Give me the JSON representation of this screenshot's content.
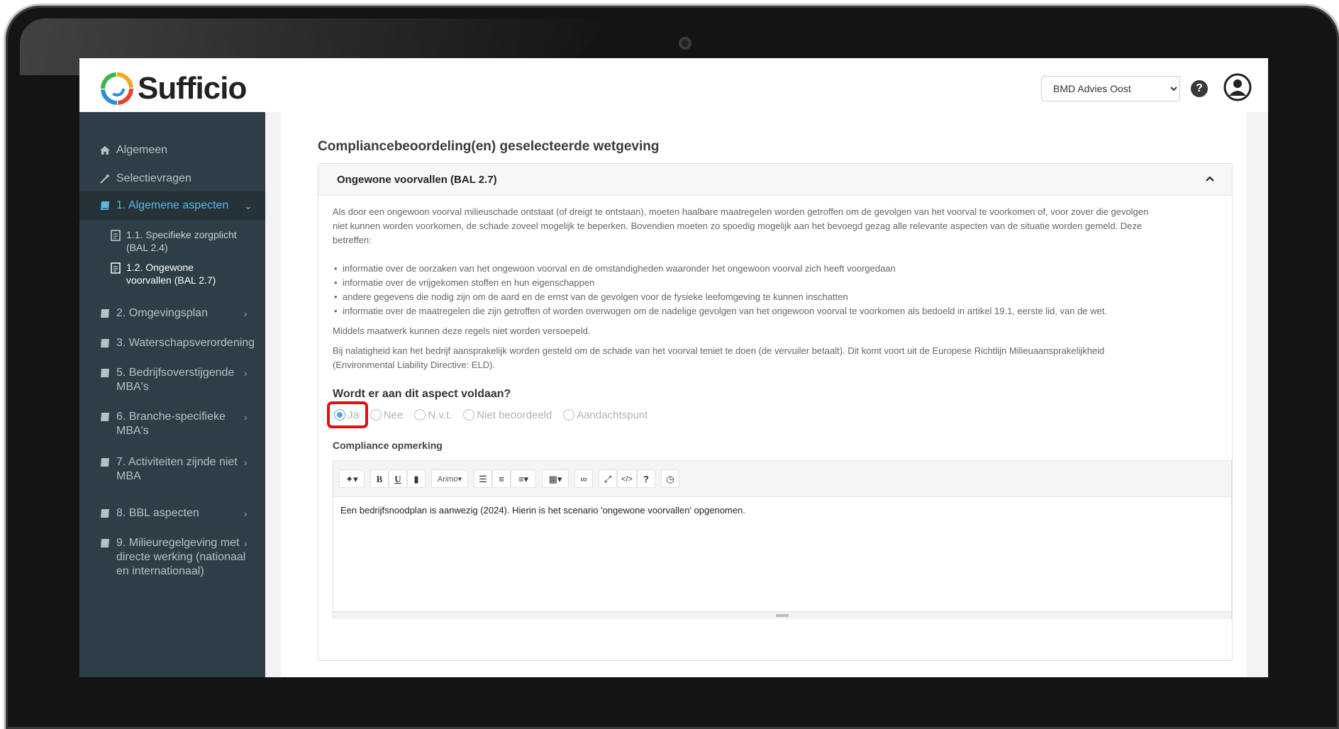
{
  "app": {
    "logo_text": "Sufficio"
  },
  "header": {
    "org_select": {
      "value": "BMD Advies Oost"
    },
    "help_label": "?"
  },
  "sidebar": {
    "items": [
      {
        "label": "Algemeen",
        "icon": "home-icon"
      },
      {
        "label": "Selectievragen",
        "icon": "magic-wand-icon"
      },
      {
        "label": "1. Algemene aspecten",
        "icon": "book-icon",
        "active": true
      },
      {
        "label": "2. Omgevingsplan",
        "icon": "book-icon"
      },
      {
        "label": "3. Waterschapsverordening",
        "icon": "book-icon"
      },
      {
        "label_line1": "5. Bedrijfsoverstijgende",
        "label_line2": "MBA's",
        "icon": "book-icon"
      },
      {
        "label_line1": "6. Branche-specifieke",
        "label_line2": "MBA's",
        "icon": "book-icon"
      },
      {
        "label_line1": "7. Activiteiten zijnde niet",
        "label_line2": "MBA",
        "icon": "book-icon"
      },
      {
        "label": "8. BBL aspecten",
        "icon": "book-icon"
      },
      {
        "label_line1": "9. Milieuregelgeving met",
        "label_line2": "directe werking (nationaal",
        "label_line3": "en internationaal)",
        "icon": "book-icon"
      }
    ],
    "subitems": [
      {
        "label_line1": "1.1. Specifieke zorgplicht",
        "label_line2": "(BAL 2.4)"
      },
      {
        "label_line1": "1.2. Ongewone",
        "label_line2": "voorvallen (BAL 2.7)",
        "current": true
      }
    ]
  },
  "main": {
    "section_title": "Compliancebeoordeling(en) geselecteerde wetgeving",
    "card_title": "Ongewone voorvallen (BAL 2.7)",
    "intro_line1": "Als door een ongewoon voorval milieuschade ontstaat (of dreigt te ontstaan), moeten haalbare maatregelen worden getroffen om de gevolgen van het voorval te voorkomen of, voor zover die gevolgen",
    "intro_line2": "niet kunnen worden voorkomen, de schade zoveel mogelijk te beperken. Bovendien moeten zo spoedig mogelijk aan het bevoegd gezag alle relevante aspecten van de situatie worden gemeld. Deze",
    "intro_line3": "betreffen:",
    "bullets": [
      "informatie over de oorzaken van het ongewoon voorval en de omstandigheden waaronder het ongewoon voorval zich heeft voorgedaan",
      "informatie over de vrijgekomen stoffen en hun eigenschappen",
      "andere gegevens die nodig zijn om de aard en de ernst van de gevolgen voor de fysieke leefomgeving te kunnen inschatten",
      "informatie over de maatregelen die zijn getroffen of worden overwogen om de nadelige gevolgen van het ongewoon voorval te voorkomen als bedoeld in artikel 19.1, eerste lid, van de wet."
    ],
    "maatwerk_text": "Middels maatwerk kunnen deze regels niet worden versoepeld.",
    "liability_line1": "Bij nalatigheid kan het bedrijf aansprakelijk worden gesteld om de schade van het voorval teniet te doen (de vervuiler betaalt). Dit komt voort uit de Europese Richtlijn Milieuaansprakelijkheid",
    "liability_line2": "(Environmental Liability Directive: ELD).",
    "question": "Wordt er aan dit aspect voldaan?",
    "radio_options": [
      {
        "label": "Ja",
        "checked": true
      },
      {
        "label": "Nee",
        "checked": false
      },
      {
        "label": "N.v.t.",
        "checked": false
      },
      {
        "label": "Niet beoordeeld",
        "checked": false
      },
      {
        "label": "Aandachtspunt",
        "checked": false
      }
    ],
    "compliance_label": "Compliance opmerking",
    "editor": {
      "font_dropdown": "Arimo",
      "bold": "B",
      "underline": "U",
      "code": "</>",
      "help": "?",
      "content": "Een bedrijfsnoodplan is aanwezig (2024). Hierin is het scenario 'ongewone voorvallen' opgenomen."
    }
  },
  "colors": {
    "sidebar_bg": "#2e3e47",
    "active_link": "#5bb8e8",
    "highlight": "#e01010",
    "radio_checked": "#5b9ee0"
  }
}
